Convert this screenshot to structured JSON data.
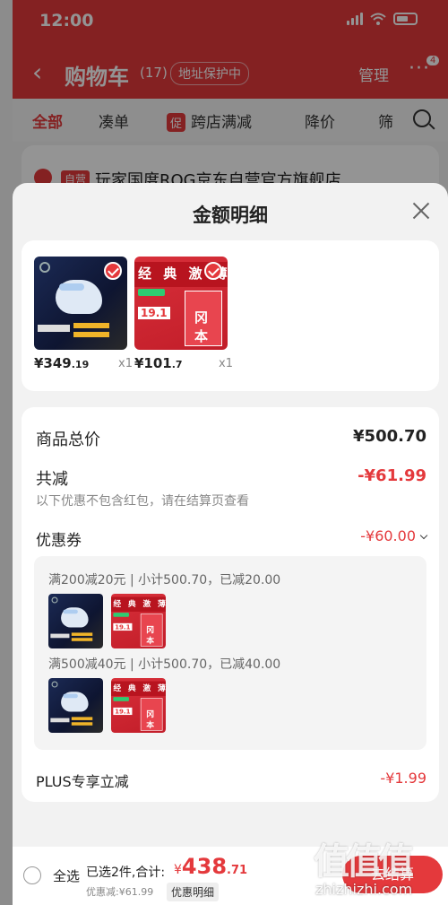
{
  "status_bar": {
    "time": "12:00"
  },
  "nav": {
    "title": "购物车",
    "count": "(17)",
    "address_protect": "地址保护中",
    "manage": "管理",
    "more_badge": "4"
  },
  "tabs": {
    "all": "全部",
    "coudan": "凑单",
    "promo_tag": "促",
    "cross_store": "跨店满减",
    "price_drop": "降价",
    "filter": "筛"
  },
  "store": {
    "tag": "自营",
    "name": "玩家国度ROG京东自营官方旗舰店"
  },
  "sheet": {
    "title": "金额明细",
    "products": [
      {
        "price_int": "¥349",
        "price_dec": ".19",
        "qty": "x1"
      },
      {
        "price_int": "¥101",
        "price_dec": ".7",
        "qty": "x1"
      }
    ],
    "product_image_text": {
      "box_big": "经 典 激 薄",
      "box_price": "19.1",
      "box_card": "冈 本"
    },
    "total_label": "商品总价",
    "total_value": "¥500.70",
    "reduce_label": "共减",
    "reduce_value": "-¥61.99",
    "reduce_note": "以下优惠不包含红包，请在结算页查看",
    "coupon_label": "优惠券",
    "coupon_value": "-¥60.00",
    "coupon_lines": [
      "满200减20元 | 小计500.70，已减20.00",
      "满500减40元 | 小计500.70，已减40.00"
    ],
    "plus_label": "PLUS专享立减",
    "plus_value": "-¥1.99"
  },
  "bottom_bar": {
    "select_all": "全选",
    "selected": "已选2件,合计:",
    "total_cur": "¥",
    "total_int": "438",
    "total_dec": ".71",
    "discount": "优惠减:¥61.99",
    "detail_button": "优惠明细",
    "checkout_button": "去结算"
  },
  "watermark": {
    "logo": "值值值",
    "url": "zhizhizhi.com"
  },
  "colors": {
    "accent": "#e4393c",
    "background": "#f2f2f2"
  }
}
